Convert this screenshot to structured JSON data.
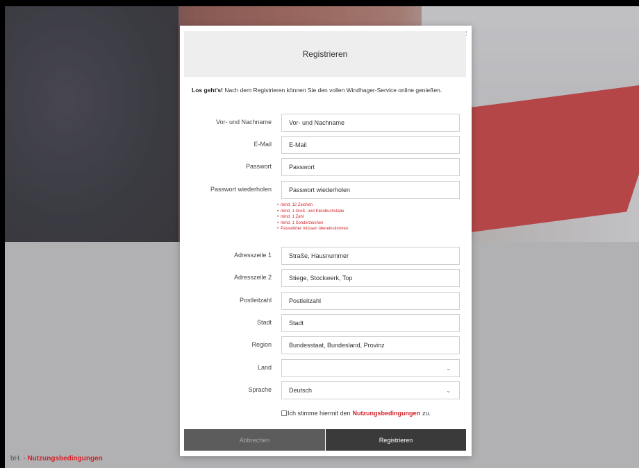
{
  "page": {
    "footer_prefix": "bH. - ",
    "footer_link": "Nutzungsbedingungen"
  },
  "modal": {
    "close_label": "×",
    "title": "Registrieren",
    "intro_bold": "Los geht's!",
    "intro_text": " Nach dem Registrieren können Sie den vollen Windhager-Service online genießen."
  },
  "form": {
    "name": {
      "label": "Vor- und Nachname",
      "placeholder": "Vor- und Nachname",
      "value": ""
    },
    "email": {
      "label": "E-Mail",
      "placeholder": "E-Mail",
      "value": ""
    },
    "password": {
      "label": "Passwort",
      "placeholder": "Passwort",
      "value": ""
    },
    "password_repeat": {
      "label": "Passwort wiederholen",
      "placeholder": "Passwort wiederholen",
      "value": ""
    },
    "password_rules": [
      "mind. 12 Zeichen",
      "mind. 1 Groß- und Kleinbuchstabe",
      "mind. 1 Zahl",
      "mind. 1 Sonderzeichen",
      "Passwörter müssen übereinstimmen"
    ],
    "address1": {
      "label": "Adresszeile 1",
      "placeholder": "Straße, Hausnummer",
      "value": ""
    },
    "address2": {
      "label": "Adresszeile 2",
      "placeholder": "Stiege, Stockwerk, Top",
      "value": ""
    },
    "zip": {
      "label": "Postleitzahl",
      "placeholder": "Postleitzahl",
      "value": ""
    },
    "city": {
      "label": "Stadt",
      "placeholder": "Stadt",
      "value": ""
    },
    "region": {
      "label": "Region",
      "placeholder": "Bundesstaat, Bundesland, Provinz",
      "value": ""
    },
    "country": {
      "label": "Land",
      "value": ""
    },
    "language": {
      "label": "Sprache",
      "value": "Deutsch"
    },
    "terms": {
      "prefix": "Ich stimme hiermit den",
      "link": "Nutzungsbedingungen",
      "suffix": "zu.",
      "checked": false
    }
  },
  "buttons": {
    "cancel": "Abbrechen",
    "submit": "Registrieren"
  },
  "colors": {
    "accent": "#d2232a",
    "button_dark": "#3a3a3a",
    "button_disabled": "#5c5c5c"
  }
}
